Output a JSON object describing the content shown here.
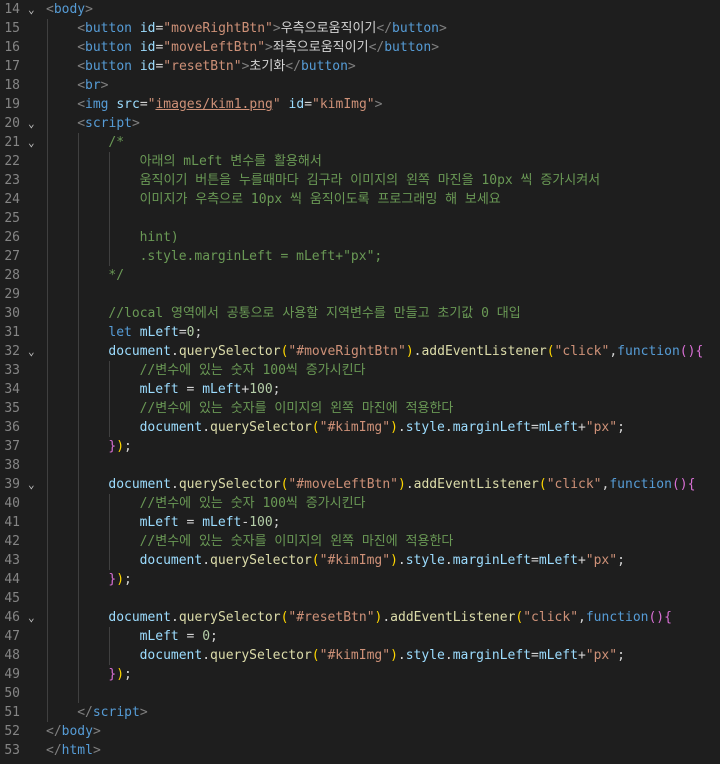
{
  "editor": {
    "theme_colors": {
      "background": "#1e1e1e",
      "line_number": "#858585",
      "tag": "#569cd6",
      "attribute": "#9cdcfe",
      "string": "#ce9178",
      "comment": "#6a9955",
      "function": "#dcdcaa",
      "number": "#b5cea8"
    },
    "lines": [
      {
        "n": "14",
        "fold": true,
        "indent": 0,
        "tokens": [
          [
            "br",
            "<"
          ],
          [
            "tag",
            "body"
          ],
          [
            "br",
            ">"
          ]
        ]
      },
      {
        "n": "15",
        "fold": false,
        "indent": 1,
        "tokens": [
          [
            "br",
            "<"
          ],
          [
            "tag",
            "button"
          ],
          [
            "txt",
            " "
          ],
          [
            "attr",
            "id"
          ],
          [
            "eq",
            "="
          ],
          [
            "str",
            "\"moveRightBtn\""
          ],
          [
            "br",
            ">"
          ],
          [
            "txt",
            "우측으로움직이기"
          ],
          [
            "br",
            "</"
          ],
          [
            "tag",
            "button"
          ],
          [
            "br",
            ">"
          ]
        ]
      },
      {
        "n": "16",
        "fold": false,
        "indent": 1,
        "tokens": [
          [
            "br",
            "<"
          ],
          [
            "tag",
            "button"
          ],
          [
            "txt",
            " "
          ],
          [
            "attr",
            "id"
          ],
          [
            "eq",
            "="
          ],
          [
            "str",
            "\"moveLeftBtn\""
          ],
          [
            "br",
            ">"
          ],
          [
            "txt",
            "좌측으로움직이기"
          ],
          [
            "br",
            "</"
          ],
          [
            "tag",
            "button"
          ],
          [
            "br",
            ">"
          ]
        ]
      },
      {
        "n": "17",
        "fold": false,
        "indent": 1,
        "tokens": [
          [
            "br",
            "<"
          ],
          [
            "tag",
            "button"
          ],
          [
            "txt",
            " "
          ],
          [
            "attr",
            "id"
          ],
          [
            "eq",
            "="
          ],
          [
            "str",
            "\"resetBtn\""
          ],
          [
            "br",
            ">"
          ],
          [
            "txt",
            "초기화"
          ],
          [
            "br",
            "</"
          ],
          [
            "tag",
            "button"
          ],
          [
            "br",
            ">"
          ]
        ]
      },
      {
        "n": "18",
        "fold": false,
        "indent": 1,
        "tokens": [
          [
            "br",
            "<"
          ],
          [
            "tag",
            "br"
          ],
          [
            "br",
            ">"
          ]
        ]
      },
      {
        "n": "19",
        "fold": false,
        "indent": 1,
        "tokens": [
          [
            "br",
            "<"
          ],
          [
            "tag",
            "img"
          ],
          [
            "txt",
            " "
          ],
          [
            "attr",
            "src"
          ],
          [
            "eq",
            "="
          ],
          [
            "str",
            "\""
          ],
          [
            "link",
            "images/kim1.png"
          ],
          [
            "str",
            "\""
          ],
          [
            "txt",
            " "
          ],
          [
            "attr",
            "id"
          ],
          [
            "eq",
            "="
          ],
          [
            "str",
            "\"kimImg\""
          ],
          [
            "br",
            ">"
          ]
        ]
      },
      {
        "n": "20",
        "fold": true,
        "indent": 1,
        "tokens": [
          [
            "br",
            "<"
          ],
          [
            "tag",
            "script"
          ],
          [
            "br",
            ">"
          ]
        ]
      },
      {
        "n": "21",
        "fold": true,
        "indent": 2,
        "tokens": [
          [
            "cm",
            "/*"
          ]
        ]
      },
      {
        "n": "22",
        "fold": false,
        "indent": 3,
        "tokens": [
          [
            "cm",
            "아래의 mLeft 변수를 활용해서"
          ]
        ]
      },
      {
        "n": "23",
        "fold": false,
        "indent": 3,
        "tokens": [
          [
            "cm",
            "움직이기 버튼을 누를때마다 김구라 이미지의 왼쪽 마진을 10px 씩 증가시켜서"
          ]
        ]
      },
      {
        "n": "24",
        "fold": false,
        "indent": 3,
        "tokens": [
          [
            "cm",
            "이미지가 우측으로 10px 씩 움직이도록 프로그래밍 해 보세요"
          ]
        ]
      },
      {
        "n": "25",
        "fold": false,
        "indent": 3,
        "tokens": []
      },
      {
        "n": "26",
        "fold": false,
        "indent": 3,
        "tokens": [
          [
            "cm",
            "hint)"
          ]
        ]
      },
      {
        "n": "27",
        "fold": false,
        "indent": 3,
        "tokens": [
          [
            "cm",
            ".style.marginLeft = mLeft+\"px\";"
          ]
        ]
      },
      {
        "n": "28",
        "fold": false,
        "indent": 2,
        "tokens": [
          [
            "cm",
            "*/"
          ]
        ]
      },
      {
        "n": "29",
        "fold": false,
        "indent": 2,
        "tokens": []
      },
      {
        "n": "30",
        "fold": false,
        "indent": 2,
        "tokens": [
          [
            "cm",
            "//local 영역에서 공통으로 사용할 지역변수를 만들고 초기값 0 대입"
          ]
        ]
      },
      {
        "n": "31",
        "fold": false,
        "indent": 2,
        "tokens": [
          [
            "kw",
            "let"
          ],
          [
            "txt",
            " "
          ],
          [
            "var",
            "mLeft"
          ],
          [
            "txt",
            "="
          ],
          [
            "num",
            "0"
          ],
          [
            "txt",
            ";"
          ]
        ]
      },
      {
        "n": "32",
        "fold": true,
        "indent": 2,
        "tokens": [
          [
            "var",
            "document"
          ],
          [
            "txt",
            "."
          ],
          [
            "fn",
            "querySelector"
          ],
          [
            "pa",
            "("
          ],
          [
            "str",
            "\"#moveRightBtn\""
          ],
          [
            "pa",
            ")"
          ],
          [
            "txt",
            "."
          ],
          [
            "fn",
            "addEventListener"
          ],
          [
            "pa",
            "("
          ],
          [
            "str",
            "\"click\""
          ],
          [
            "txt",
            ","
          ],
          [
            "kw",
            "function"
          ],
          [
            "pb",
            "()"
          ],
          [
            "pb",
            "{"
          ]
        ]
      },
      {
        "n": "33",
        "fold": false,
        "indent": 3,
        "tokens": [
          [
            "cm",
            "//변수에 있는 숫자 100씩 증가시킨다"
          ]
        ]
      },
      {
        "n": "34",
        "fold": false,
        "indent": 3,
        "tokens": [
          [
            "var",
            "mLeft"
          ],
          [
            "txt",
            " = "
          ],
          [
            "var",
            "mLeft"
          ],
          [
            "txt",
            "+"
          ],
          [
            "num",
            "100"
          ],
          [
            "txt",
            ";"
          ]
        ]
      },
      {
        "n": "35",
        "fold": false,
        "indent": 3,
        "tokens": [
          [
            "cm",
            "//변수에 있는 숫자를 이미지의 왼쪽 마진에 적용한다"
          ]
        ]
      },
      {
        "n": "36",
        "fold": false,
        "indent": 3,
        "tokens": [
          [
            "var",
            "document"
          ],
          [
            "txt",
            "."
          ],
          [
            "fn",
            "querySelector"
          ],
          [
            "pa",
            "("
          ],
          [
            "str",
            "\"#kimImg\""
          ],
          [
            "pa",
            ")"
          ],
          [
            "txt",
            "."
          ],
          [
            "var",
            "style"
          ],
          [
            "txt",
            "."
          ],
          [
            "var",
            "marginLeft"
          ],
          [
            "txt",
            "="
          ],
          [
            "var",
            "mLeft"
          ],
          [
            "txt",
            "+"
          ],
          [
            "str",
            "\"px\""
          ],
          [
            "txt",
            ";"
          ]
        ]
      },
      {
        "n": "37",
        "fold": false,
        "indent": 2,
        "tokens": [
          [
            "pb",
            "}"
          ],
          [
            "pa",
            ")"
          ],
          [
            "txt",
            ";"
          ]
        ]
      },
      {
        "n": "38",
        "fold": false,
        "indent": 2,
        "tokens": []
      },
      {
        "n": "39",
        "fold": true,
        "indent": 2,
        "tokens": [
          [
            "var",
            "document"
          ],
          [
            "txt",
            "."
          ],
          [
            "fn",
            "querySelector"
          ],
          [
            "pa",
            "("
          ],
          [
            "str",
            "\"#moveLeftBtn\""
          ],
          [
            "pa",
            ")"
          ],
          [
            "txt",
            "."
          ],
          [
            "fn",
            "addEventListener"
          ],
          [
            "pa",
            "("
          ],
          [
            "str",
            "\"click\""
          ],
          [
            "txt",
            ","
          ],
          [
            "kw",
            "function"
          ],
          [
            "pb",
            "()"
          ],
          [
            "pb",
            "{"
          ]
        ]
      },
      {
        "n": "40",
        "fold": false,
        "indent": 3,
        "tokens": [
          [
            "cm",
            "//변수에 있는 숫자 100씩 증가시킨다"
          ]
        ]
      },
      {
        "n": "41",
        "fold": false,
        "indent": 3,
        "tokens": [
          [
            "var",
            "mLeft"
          ],
          [
            "txt",
            " = "
          ],
          [
            "var",
            "mLeft"
          ],
          [
            "txt",
            "-"
          ],
          [
            "num",
            "100"
          ],
          [
            "txt",
            ";"
          ]
        ]
      },
      {
        "n": "42",
        "fold": false,
        "indent": 3,
        "tokens": [
          [
            "cm",
            "//변수에 있는 숫자를 이미지의 왼쪽 마진에 적용한다"
          ]
        ]
      },
      {
        "n": "43",
        "fold": false,
        "indent": 3,
        "tokens": [
          [
            "var",
            "document"
          ],
          [
            "txt",
            "."
          ],
          [
            "fn",
            "querySelector"
          ],
          [
            "pa",
            "("
          ],
          [
            "str",
            "\"#kimImg\""
          ],
          [
            "pa",
            ")"
          ],
          [
            "txt",
            "."
          ],
          [
            "var",
            "style"
          ],
          [
            "txt",
            "."
          ],
          [
            "var",
            "marginLeft"
          ],
          [
            "txt",
            "="
          ],
          [
            "var",
            "mLeft"
          ],
          [
            "txt",
            "+"
          ],
          [
            "str",
            "\"px\""
          ],
          [
            "txt",
            ";"
          ]
        ]
      },
      {
        "n": "44",
        "fold": false,
        "indent": 2,
        "tokens": [
          [
            "pb",
            "}"
          ],
          [
            "pa",
            ")"
          ],
          [
            "txt",
            ";"
          ]
        ]
      },
      {
        "n": "45",
        "fold": false,
        "indent": 2,
        "tokens": []
      },
      {
        "n": "46",
        "fold": true,
        "indent": 2,
        "tokens": [
          [
            "var",
            "document"
          ],
          [
            "txt",
            "."
          ],
          [
            "fn",
            "querySelector"
          ],
          [
            "pa",
            "("
          ],
          [
            "str",
            "\"#resetBtn\""
          ],
          [
            "pa",
            ")"
          ],
          [
            "txt",
            "."
          ],
          [
            "fn",
            "addEventListener"
          ],
          [
            "pa",
            "("
          ],
          [
            "str",
            "\"click\""
          ],
          [
            "txt",
            ","
          ],
          [
            "kw",
            "function"
          ],
          [
            "pb",
            "()"
          ],
          [
            "pb",
            "{"
          ]
        ]
      },
      {
        "n": "47",
        "fold": false,
        "indent": 3,
        "tokens": [
          [
            "var",
            "mLeft"
          ],
          [
            "txt",
            " = "
          ],
          [
            "num",
            "0"
          ],
          [
            "txt",
            ";"
          ]
        ]
      },
      {
        "n": "48",
        "fold": false,
        "indent": 3,
        "tokens": [
          [
            "var",
            "document"
          ],
          [
            "txt",
            "."
          ],
          [
            "fn",
            "querySelector"
          ],
          [
            "pa",
            "("
          ],
          [
            "str",
            "\"#kimImg\""
          ],
          [
            "pa",
            ")"
          ],
          [
            "txt",
            "."
          ],
          [
            "var",
            "style"
          ],
          [
            "txt",
            "."
          ],
          [
            "var",
            "marginLeft"
          ],
          [
            "txt",
            "="
          ],
          [
            "var",
            "mLeft"
          ],
          [
            "txt",
            "+"
          ],
          [
            "str",
            "\"px\""
          ],
          [
            "txt",
            ";"
          ]
        ]
      },
      {
        "n": "49",
        "fold": false,
        "indent": 2,
        "tokens": [
          [
            "pb",
            "}"
          ],
          [
            "pa",
            ")"
          ],
          [
            "txt",
            ";"
          ]
        ]
      },
      {
        "n": "50",
        "fold": false,
        "indent": 2,
        "tokens": []
      },
      {
        "n": "51",
        "fold": false,
        "indent": 1,
        "tokens": [
          [
            "br",
            "</"
          ],
          [
            "tag",
            "script"
          ],
          [
            "br",
            ">"
          ]
        ]
      },
      {
        "n": "52",
        "fold": false,
        "indent": 0,
        "tokens": [
          [
            "br",
            "</"
          ],
          [
            "tag",
            "body"
          ],
          [
            "br",
            ">"
          ]
        ]
      },
      {
        "n": "53",
        "fold": false,
        "indent": 0,
        "tokens": [
          [
            "br",
            "</"
          ],
          [
            "tag",
            "html"
          ],
          [
            "br",
            ">"
          ]
        ]
      }
    ]
  }
}
